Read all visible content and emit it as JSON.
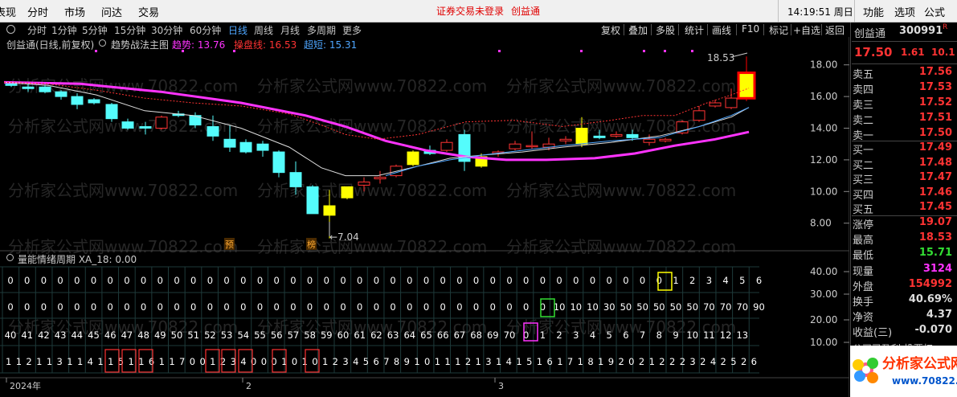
{
  "menu": {
    "items": [
      "表现",
      "分时",
      "市场",
      "问达",
      "交易"
    ],
    "warning": "证券交易未登录",
    "product": "创益通",
    "clock": "14:19:51 周日",
    "right_items": [
      "功能",
      "选项",
      "公式"
    ]
  },
  "periods": [
    "分时",
    "1分钟",
    "5分钟",
    "15分钟",
    "30分钟",
    "60分钟",
    "日线",
    "周线",
    "月线",
    "多周期",
    "更多"
  ],
  "active_period": "日线",
  "toolbar_buttons": [
    "复权",
    "叠加",
    "多股",
    "统计",
    "画线",
    "F10",
    "标记",
    "+自选",
    "返回"
  ],
  "main_header": {
    "title": "创益通(日线,前复权)",
    "indicator": "趋势战法主图",
    "items": [
      {
        "label": "趋势: 13.76",
        "color": "#ff33ff"
      },
      {
        "label": "操盘线: 16.53",
        "color": "#ff3333"
      },
      {
        "label": "超短: 15.31",
        "color": "#4ea6ff"
      }
    ]
  },
  "price_axis": [
    "18.00",
    "16.00",
    "14.00",
    "12.00",
    "10.00",
    "8.00"
  ],
  "annotations": {
    "high": "18.53",
    "low": "←7.04",
    "mark1": "预",
    "mark2": "榜"
  },
  "watermark": "分析家公式网www.70822.com",
  "sub_header": "量能情绪周期  XA_18: 0.00",
  "sub_axis": [
    "40.00",
    "30.00",
    "20.00",
    "10.00"
  ],
  "grid_rows": [
    [
      "0",
      "0",
      "0",
      "0",
      "0",
      "0",
      "0",
      "0",
      "0",
      "0",
      "0",
      "0",
      "0",
      "0",
      "0",
      "0",
      "0",
      "0",
      "0",
      "0",
      "0",
      "0",
      "0",
      "0",
      "0",
      "0",
      "0",
      "0",
      "0",
      "0",
      "0",
      "0",
      "0",
      "0",
      "0",
      "0",
      "0",
      "0",
      "0",
      "0",
      "1",
      "2",
      "3",
      "4",
      "5",
      "6"
    ],
    [
      "0",
      "0",
      "0",
      "0",
      "0",
      "0",
      "0",
      "0",
      "0",
      "0",
      "0",
      "0",
      "0",
      "0",
      "0",
      "0",
      "0",
      "0",
      "0",
      "0",
      "0",
      "0",
      "0",
      "0",
      "0",
      "0",
      "0",
      "0",
      "0",
      "0",
      "0",
      "0",
      "0",
      "10",
      "10",
      "10",
      "30",
      "50",
      "50",
      "50",
      "50",
      "50",
      "70",
      "70",
      "70",
      "90"
    ],
    [
      "40",
      "41",
      "42",
      "43",
      "44",
      "45",
      "46",
      "47",
      "48",
      "49",
      "50",
      "51",
      "52",
      "53",
      "54",
      "55",
      "56",
      "57",
      "58",
      "59",
      "60",
      "61",
      "62",
      "63",
      "64",
      "65",
      "66",
      "67",
      "68",
      "69",
      "70",
      "0",
      "1",
      "2",
      "3",
      "4",
      "5",
      "6",
      "7",
      "8",
      "9",
      "10",
      "11",
      "12",
      "13"
    ],
    [
      "11",
      "12",
      "11",
      "13",
      "11",
      "14",
      "11",
      "15",
      "11",
      "16",
      "11",
      "70",
      "0",
      "1",
      "2",
      "3",
      "4",
      "0",
      "0",
      "0",
      "1",
      "0",
      "1",
      "0",
      "1",
      "2",
      "3",
      "4",
      "5",
      "6",
      "7",
      "8",
      "9",
      "10",
      "11",
      "12",
      "13",
      "14",
      "15",
      "16",
      "17",
      "18",
      "19",
      "20",
      "21",
      "22",
      "23",
      "24",
      "25",
      "26"
    ]
  ],
  "row4_display": "11211311411511611700123400010101234567891011121314151617181920212223242526",
  "date_axis": [
    "2024年",
    "2",
    "3"
  ],
  "quote": {
    "name": "创益通",
    "code": "300991",
    "r_flag": "R",
    "price": "17.50",
    "change": "1.61",
    "pct": "10.1",
    "asks": [
      {
        "label": "卖五",
        "value": "17.56"
      },
      {
        "label": "卖四",
        "value": "17.53"
      },
      {
        "label": "卖三",
        "value": "17.52"
      },
      {
        "label": "卖二",
        "value": "17.51"
      },
      {
        "label": "卖一",
        "value": "17.50"
      }
    ],
    "bids": [
      {
        "label": "买一",
        "value": "17.49"
      },
      {
        "label": "买二",
        "value": "17.48"
      },
      {
        "label": "买三",
        "value": "17.47"
      },
      {
        "label": "买四",
        "value": "17.46"
      },
      {
        "label": "买五",
        "value": "17.45"
      }
    ],
    "stats": [
      {
        "label": "涨停",
        "value": "19.07",
        "color": "#ff3333"
      },
      {
        "label": "最高",
        "value": "18.53",
        "color": "#ff3333"
      },
      {
        "label": "最低",
        "value": "15.71",
        "color": "#33dd33"
      },
      {
        "label": "现量",
        "value": "3124",
        "color": "#ff33ff"
      },
      {
        "label": "外盘",
        "value": "154992",
        "color": "#ff3333"
      },
      {
        "label": "换手",
        "value": "40.69%",
        "color": "#dddddd"
      },
      {
        "label": "净资",
        "value": "4.37",
        "color": "#dddddd"
      },
      {
        "label": "收益(三)",
        "value": "-0.070",
        "color": "#dddddd"
      }
    ],
    "footer": "公司已盈利 投票权"
  },
  "logo": {
    "text": "分析家公式网",
    "url": "www.70822.com"
  }
}
